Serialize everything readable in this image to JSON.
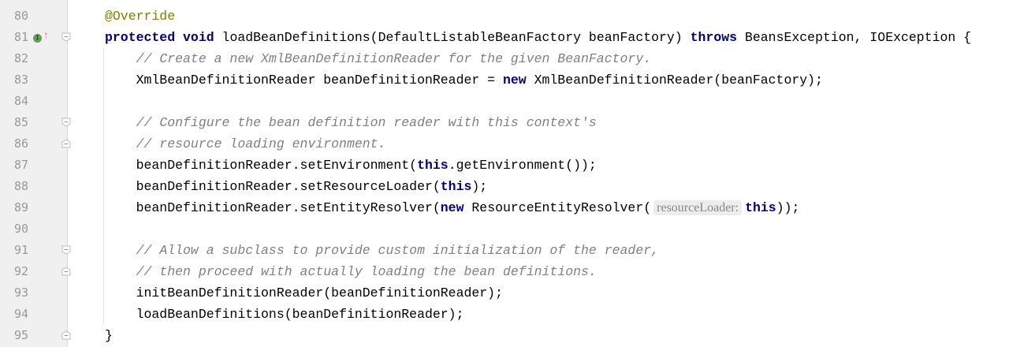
{
  "lines": [
    {
      "n": "80",
      "tokens": [
        [
          "an",
          "@Override"
        ]
      ]
    },
    {
      "n": "81",
      "tokens": [
        [
          "kw",
          "protected"
        ],
        [
          "",
          ""
        ],
        [
          "kw",
          " void"
        ],
        [
          "",
          " loadBeanDefinitions(DefaultListableBeanFactory beanFactory) "
        ],
        [
          "kw",
          "throws"
        ],
        [
          "",
          " BeansException, IOException {"
        ]
      ],
      "fold": "open",
      "markers": true
    },
    {
      "n": "82",
      "tokens": [
        [
          "",
          "    "
        ],
        [
          "cm",
          "// Create a new XmlBeanDefinitionReader for the given BeanFactory."
        ]
      ]
    },
    {
      "n": "83",
      "tokens": [
        [
          "",
          "    XmlBeanDefinitionReader beanDefinitionReader = "
        ],
        [
          "kw",
          "new"
        ],
        [
          "",
          " XmlBeanDefinitionReader(beanFactory);"
        ]
      ]
    },
    {
      "n": "84",
      "tokens": []
    },
    {
      "n": "85",
      "tokens": [
        [
          "",
          "    "
        ],
        [
          "cm",
          "// Configure the bean definition reader with this context's"
        ]
      ],
      "fold": "open"
    },
    {
      "n": "86",
      "tokens": [
        [
          "",
          "    "
        ],
        [
          "cm",
          "// resource loading environment."
        ]
      ],
      "fold": "close"
    },
    {
      "n": "87",
      "tokens": [
        [
          "",
          "    beanDefinitionReader.setEnvironment("
        ],
        [
          "kw",
          "this"
        ],
        [
          "",
          ".getEnvironment());"
        ]
      ]
    },
    {
      "n": "88",
      "tokens": [
        [
          "",
          "    beanDefinitionReader.setResourceLoader("
        ],
        [
          "kw",
          "this"
        ],
        [
          "",
          ");"
        ]
      ]
    },
    {
      "n": "89",
      "tokens": [
        [
          "",
          "    beanDefinitionReader.setEntityResolver("
        ],
        [
          "kw",
          "new"
        ],
        [
          "",
          " ResourceEntityResolver("
        ],
        [
          "hint",
          "resourceLoader:"
        ],
        [
          "kw",
          "this"
        ],
        [
          "",
          "));"
        ]
      ]
    },
    {
      "n": "90",
      "tokens": []
    },
    {
      "n": "91",
      "tokens": [
        [
          "",
          "    "
        ],
        [
          "cm",
          "// Allow a subclass to provide custom initialization of the reader,"
        ]
      ],
      "fold": "open"
    },
    {
      "n": "92",
      "tokens": [
        [
          "",
          "    "
        ],
        [
          "cm",
          "// then proceed with actually loading the bean definitions."
        ]
      ],
      "fold": "close"
    },
    {
      "n": "93",
      "tokens": [
        [
          "",
          "    initBeanDefinitionReader(beanDefinitionReader);"
        ]
      ]
    },
    {
      "n": "94",
      "tokens": [
        [
          "",
          "    loadBeanDefinitions(beanDefinitionReader);"
        ]
      ]
    },
    {
      "n": "95",
      "tokens": [
        [
          "",
          "}"
        ]
      ],
      "fold": "close"
    }
  ],
  "gutter_markers": {
    "implements_label": "I",
    "override_arrow": "↑"
  }
}
